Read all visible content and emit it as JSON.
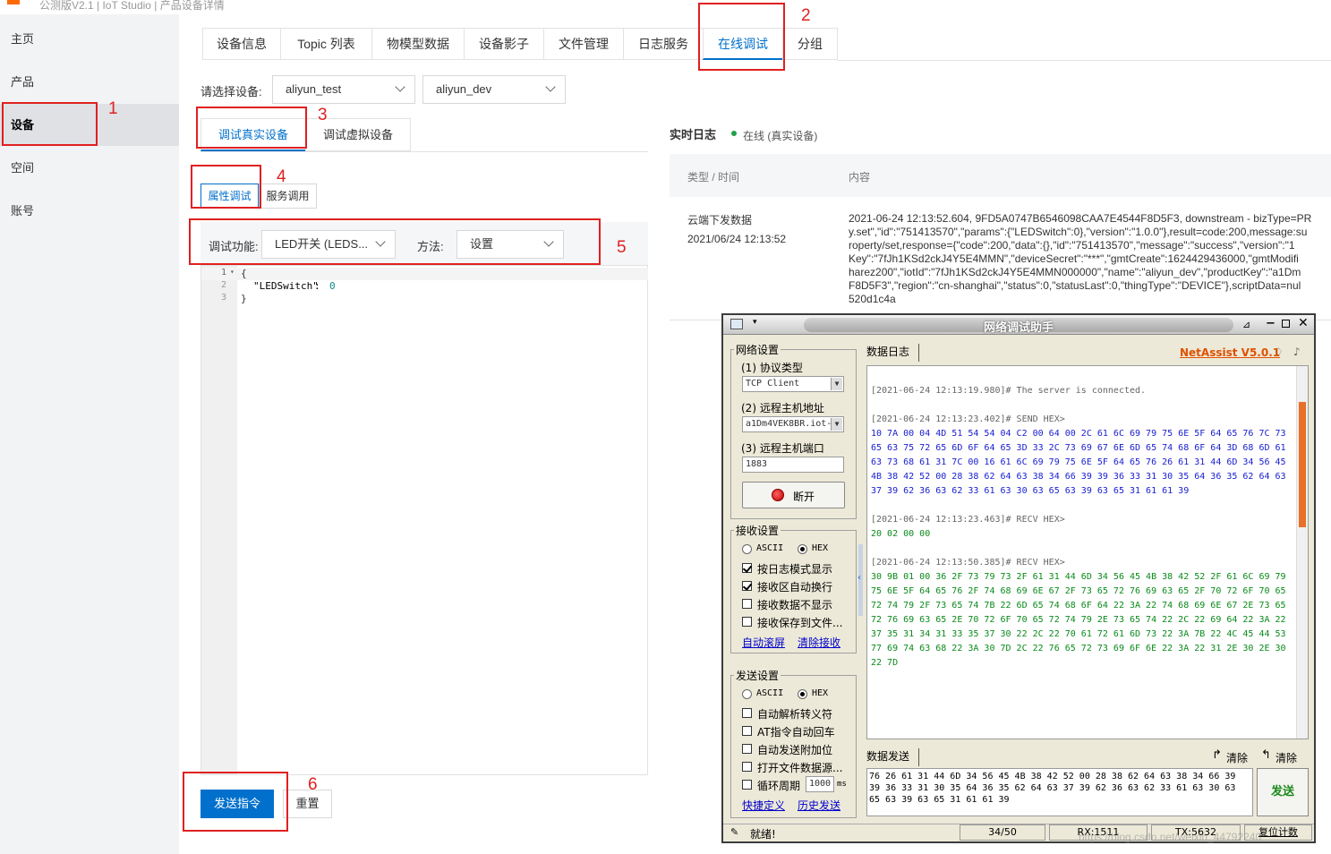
{
  "header": {
    "title": "公测版V2.1 | IoT Studio | 产品设备详情"
  },
  "sidebar": {
    "items": [
      {
        "label": "主页"
      },
      {
        "label": "产品"
      },
      {
        "label": "设备"
      },
      {
        "label": "空间"
      },
      {
        "label": "账号"
      }
    ]
  },
  "tabs": [
    {
      "label": "设备信息"
    },
    {
      "label": "Topic 列表"
    },
    {
      "label": "物模型数据"
    },
    {
      "label": "设备影子"
    },
    {
      "label": "文件管理"
    },
    {
      "label": "日志服务"
    },
    {
      "label": "在线调试"
    },
    {
      "label": "分组"
    }
  ],
  "device_select": {
    "label": "请选择设备:",
    "product": "aliyun_test",
    "device": "aliyun_dev"
  },
  "debug_tabs": {
    "real": "调试真实设备",
    "virtual": "调试虚拟设备"
  },
  "sub_tabs": {
    "property": "属性调试",
    "service": "服务调用"
  },
  "function_row": {
    "label": "调试功能:",
    "value": "LED开关 (LEDS...",
    "method_label": "方法:",
    "method_value": "设置"
  },
  "editor": {
    "lines": [
      {
        "num": "1",
        "code": "{"
      },
      {
        "num": "2",
        "key": "\"LEDSwitch\"",
        "value": "0"
      },
      {
        "num": "3",
        "code": "}"
      }
    ]
  },
  "buttons": {
    "send": "发送指令",
    "reset": "重置"
  },
  "log_panel": {
    "title": "实时日志",
    "status": "在线 (真实设备)",
    "col_type": "类型 / 时间",
    "col_content": "内容",
    "entry_type": "云端下发数据",
    "entry_time": "2021/06/24 12:13:52",
    "entry_lines": [
      "2021-06-24 12:13:52.604, 9FD5A0747B6546098CAA7E4544F8D5F3, downstream - bizType=PR",
      "y.set\",\"id\":\"751413570\",\"params\":{\"LEDSwitch\":0},\"version\":\"1.0.0\"},result=code:200,message:su",
      "roperty/set,response={\"code\":200,\"data\":{},\"id\":\"751413570\",\"message\":\"success\",\"version\":\"1",
      "Key\":\"7fJh1KSd2ckJ4Y5E4MMN\",\"deviceSecret\":\"***\",\"gmtCreate\":1624429436000,\"gmtModifi",
      "harez200\",\"iotId\":\"7fJh1KSd2ckJ4Y5E4MMN000000\",\"name\":\"aliyun_dev\",\"productKey\":\"a1Dm",
      "F8D5F3\",\"region\":\"cn-shanghai\",\"status\":0,\"statusLast\":0,\"thingType\":\"DEVICE\"},scriptData=nul",
      "520d1c4a"
    ]
  },
  "annotations": [
    "1",
    "2",
    "3",
    "4",
    "5",
    "6"
  ],
  "netassist": {
    "title": "网络调试助手",
    "brand": "NetAssist V5.0.1",
    "net_settings": {
      "legend": "网络设置",
      "protocol_label": "(1) 协议类型",
      "protocol_value": "TCP Client",
      "host_label": "(2) 远程主机地址",
      "host_value": "a1Dm4VEK8BR.iot-",
      "port_label": "(3) 远程主机端口",
      "port_value": "1883",
      "disconnect": "断开"
    },
    "recv_settings": {
      "legend": "接收设置",
      "ascii": "ASCII",
      "hex": "HEX",
      "options": [
        "按日志模式显示",
        "接收区自动换行",
        "接收数据不显示",
        "接收保存到文件..."
      ],
      "link1": "自动滚屏",
      "link2": "清除接收"
    },
    "send_settings": {
      "legend": "发送设置",
      "ascii": "ASCII",
      "hex": "HEX",
      "options": [
        "自动解析转义符",
        "AT指令自动回车",
        "自动发送附加位",
        "打开文件数据源..."
      ],
      "loop_label": "循环周期",
      "loop_value": "1000",
      "loop_unit": "ms",
      "link1": "快捷定义",
      "link2": "历史发送"
    },
    "data_log_title": "数据日志",
    "log": [
      {
        "cls": "log-grey",
        "text": "[2021-06-24 12:13:19.980]# The server is connected."
      },
      {
        "cls": "log-grey",
        "text": "[2021-06-24 12:13:23.402]# SEND HEX>"
      },
      {
        "cls": "log-blue",
        "text": "10 7A 00 04 4D 51 54 54 04 C2 00 64 00 2C 61 6C 69 79 75 6E 5F 64 65 76 7C 73"
      },
      {
        "cls": "log-blue",
        "text": "65 63 75 72 65 6D 6F 64 65 3D 33 2C 73 69 67 6E 6D 65 74 68 6F 64 3D 68 6D 61"
      },
      {
        "cls": "log-blue",
        "text": "63 73 68 61 31 7C 00 16 61 6C 69 79 75 6E 5F 64 65 76 26 61 31 44 6D 34 56 45"
      },
      {
        "cls": "log-blue",
        "text": "4B 38 42 52 00 28 38 62 64 63 38 34 66 39 39 36 33 31 30 35 64 36 35 62 64 63"
      },
      {
        "cls": "log-blue",
        "text": "37 39 62 36 63 62 33 61 63 30 63 65 63 39 63 65 31 61 61 39"
      },
      {
        "cls": "log-grey",
        "text": "[2021-06-24 12:13:23.463]# RECV HEX>"
      },
      {
        "cls": "log-green",
        "text": "20 02 00 00"
      },
      {
        "cls": "log-grey",
        "text": "[2021-06-24 12:13:50.385]# RECV HEX>"
      },
      {
        "cls": "log-green",
        "text": "30 9B 01 00 36 2F 73 79 73 2F 61 31 44 6D 34 56 45 4B 38 42 52 2F 61 6C 69 79"
      },
      {
        "cls": "log-green",
        "text": "75 6E 5F 64 65 76 2F 74 68 69 6E 67 2F 73 65 72 76 69 63 65 2F 70 72 6F 70 65"
      },
      {
        "cls": "log-green",
        "text": "72 74 79 2F 73 65 74 7B 22 6D 65 74 68 6F 64 22 3A 22 74 68 69 6E 67 2E 73 65"
      },
      {
        "cls": "log-green",
        "text": "72 76 69 63 65 2E 70 72 6F 70 65 72 74 79 2E 73 65 74 22 2C 22 69 64 22 3A 22"
      },
      {
        "cls": "log-green",
        "text": "37 35 31 34 31 33 35 37 30 22 2C 22 70 61 72 61 6D 73 22 3A 7B 22 4C 45 44 53"
      },
      {
        "cls": "log-green",
        "text": "77 69 74 63 68 22 3A 30 7D 2C 22 76 65 72 73 69 6F 6E 22 3A 22 31 2E 30 2E 30"
      },
      {
        "cls": "log-green",
        "text": "22 7D"
      }
    ],
    "data_send_title": "数据发送",
    "clear1": "清除",
    "clear2": "清除",
    "send_text": [
      "76 26 61 31 44 6D 34 56 45 4B 38 42 52 00 28 38 62 64 63 38 34 66 39",
      "39 36 33 31 30 35 64 36 35 62 64 63 37 39 62 36 63 62 33 61 63 30 63",
      "65 63 39 63 65 31 61 61 39"
    ],
    "send_button": "发送",
    "status": {
      "ready": "就绪!",
      "count": "34/50",
      "rx": "RX:1511",
      "tx": "TX:5632",
      "reset": "复位计数"
    },
    "watermark": "https://blog.csdn.net/weixin_44792240"
  }
}
